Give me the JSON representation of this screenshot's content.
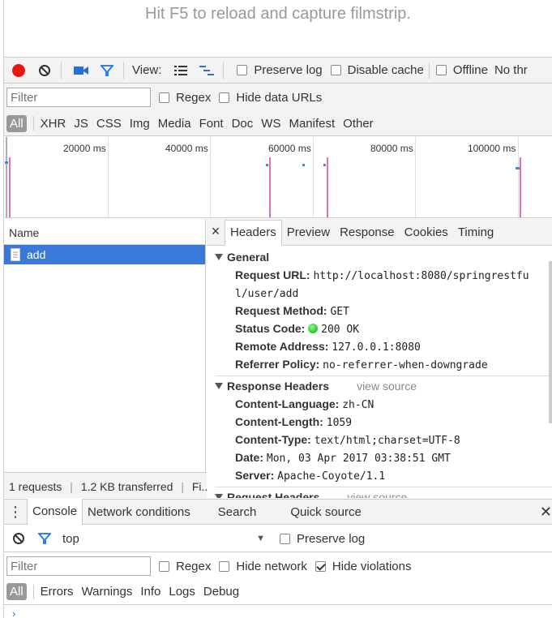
{
  "hint": "Hit F5 to reload and capture filmstrip.",
  "toolbar": {
    "view_label": "View:",
    "preserve_log": "Preserve log",
    "disable_cache": "Disable cache",
    "offline": "Offline",
    "throttle": "No thr",
    "colors": {
      "record": "#e8170b",
      "camera": "#2a6fd6",
      "filter": "#1a73e8"
    }
  },
  "filter_bar": {
    "placeholder": "Filter",
    "regex": "Regex",
    "hide_data_urls": "Hide data URLs"
  },
  "types": [
    "All",
    "XHR",
    "JS",
    "CSS",
    "Img",
    "Media",
    "Font",
    "Doc",
    "WS",
    "Manifest",
    "Other"
  ],
  "overview": {
    "ticks": [
      "20000 ms",
      "40000 ms",
      "60000 ms",
      "80000 ms",
      "100000 ms"
    ]
  },
  "requests": {
    "header": "Name",
    "items": [
      {
        "name": "add"
      }
    ],
    "status": {
      "count": "1 requests",
      "transferred": "1.2 KB transferred",
      "more": "Fi..."
    }
  },
  "details": {
    "tabs": [
      "Headers",
      "Preview",
      "Response",
      "Cookies",
      "Timing"
    ],
    "general": {
      "title": "General",
      "request_url_label": "Request URL:",
      "request_url_1": "http://localhost:8080/springrestfu",
      "request_url_2": "l/user/add",
      "method_label": "Request Method:",
      "method": "GET",
      "status_label": "Status Code:",
      "status": "200 OK",
      "remote_label": "Remote Address:",
      "remote": "127.0.0.1:8080",
      "referrer_label": "Referrer Policy:",
      "referrer": "no-referrer-when-downgrade"
    },
    "response_headers": {
      "title": "Response Headers",
      "view_source": "view source",
      "lang_label": "Content-Language:",
      "lang": "zh-CN",
      "length_label": "Content-Length:",
      "length": "1059",
      "type_label": "Content-Type:",
      "type": "text/html;charset=UTF-8",
      "date_label": "Date:",
      "date": "Mon, 03 Apr 2017 03:38:51 GMT",
      "server_label": "Server:",
      "server": "Apache-Coyote/1.1"
    },
    "request_headers": {
      "title": "Request Headers",
      "view_source": "view source"
    }
  },
  "drawer": {
    "tabs": [
      "Console",
      "Network conditions",
      "Search",
      "Quick source"
    ],
    "context": "top",
    "preserve_log": "Preserve log",
    "filter_placeholder": "Filter",
    "regex": "Regex",
    "hide_network": "Hide network",
    "hide_violations": "Hide violations",
    "levels": [
      "All",
      "Errors",
      "Warnings",
      "Info",
      "Logs",
      "Debug"
    ]
  }
}
